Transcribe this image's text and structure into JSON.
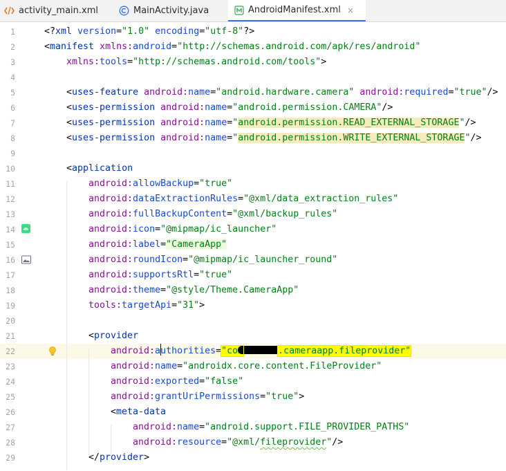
{
  "tabs": [
    {
      "label": "activity_main.xml",
      "icon": "xml-icon",
      "active": false
    },
    {
      "label": "MainActivity.java",
      "icon": "class-icon",
      "active": false
    },
    {
      "label": "AndroidManifest.xml",
      "icon": "manifest-icon",
      "active": true,
      "close": "×"
    }
  ],
  "gutter_icons": {
    "line14": "android-icon",
    "line16": "image-icon",
    "line22": "lightbulb-icon"
  },
  "lines": [
    {
      "n": "1",
      "indent": 0,
      "tokens": [
        [
          "p",
          "<?"
        ],
        [
          "k",
          "xml "
        ],
        [
          "at",
          "version"
        ],
        [
          "p",
          "="
        ],
        [
          "v",
          "\"1.0\""
        ],
        [
          "p",
          " "
        ],
        [
          "at",
          "encoding"
        ],
        [
          "p",
          "="
        ],
        [
          "v",
          "\"utf-8\""
        ],
        [
          "p",
          "?>"
        ]
      ]
    },
    {
      "n": "2",
      "indent": 0,
      "tokens": [
        [
          "p",
          "<"
        ],
        [
          "k",
          "manifest"
        ],
        [
          "p",
          " "
        ],
        [
          "ns",
          "xmlns:"
        ],
        [
          "at",
          "android"
        ],
        [
          "p",
          "="
        ],
        [
          "v",
          "\"http://schemas.android.com/apk/res/android\""
        ]
      ]
    },
    {
      "n": "3",
      "indent": 1,
      "tokens": [
        [
          "ns",
          "xmlns:"
        ],
        [
          "at",
          "tools"
        ],
        [
          "p",
          "="
        ],
        [
          "v",
          "\"http://schemas.android.com/tools\""
        ],
        [
          "p",
          ">"
        ]
      ]
    },
    {
      "n": "4",
      "indent": 0,
      "tokens": []
    },
    {
      "n": "5",
      "indent": 1,
      "tokens": [
        [
          "p",
          "<"
        ],
        [
          "k",
          "uses-feature"
        ],
        [
          "p",
          " "
        ],
        [
          "ns",
          "android:"
        ],
        [
          "at",
          "name"
        ],
        [
          "p",
          "="
        ],
        [
          "v",
          "\"android.hardware.camera\""
        ],
        [
          "p",
          " "
        ],
        [
          "ns",
          "android:"
        ],
        [
          "at",
          "required"
        ],
        [
          "p",
          "="
        ],
        [
          "v",
          "\"true\""
        ],
        [
          "p",
          "/>"
        ]
      ]
    },
    {
      "n": "6",
      "indent": 1,
      "tokens": [
        [
          "p",
          "<"
        ],
        [
          "k",
          "uses-permission"
        ],
        [
          "p",
          " "
        ],
        [
          "ns",
          "android:"
        ],
        [
          "at",
          "name"
        ],
        [
          "p",
          "="
        ],
        [
          "v",
          "\"android.permission.CAMERA\""
        ],
        [
          "p",
          "/>"
        ]
      ]
    },
    {
      "n": "7",
      "indent": 1,
      "tokens": [
        [
          "p",
          "<"
        ],
        [
          "k",
          "uses-permission"
        ],
        [
          "p",
          " "
        ],
        [
          "ns",
          "android:"
        ],
        [
          "at",
          "name"
        ],
        [
          "p",
          "="
        ],
        [
          "v",
          "\""
        ],
        [
          "v hlw",
          "android.permission.READ_EXTERNAL_STORAGE"
        ],
        [
          "v",
          "\""
        ],
        [
          "p",
          "/>"
        ]
      ]
    },
    {
      "n": "8",
      "indent": 1,
      "tokens": [
        [
          "p",
          "<"
        ],
        [
          "k",
          "uses-permission"
        ],
        [
          "p",
          " "
        ],
        [
          "ns",
          "android:"
        ],
        [
          "at",
          "name"
        ],
        [
          "p",
          "="
        ],
        [
          "v",
          "\""
        ],
        [
          "v hlw",
          "android.permission.WRITE_EXTERNAL_STORAGE"
        ],
        [
          "v",
          "\""
        ],
        [
          "p",
          "/>"
        ]
      ]
    },
    {
      "n": "9",
      "indent": 0,
      "tokens": []
    },
    {
      "n": "10",
      "indent": 1,
      "tokens": [
        [
          "p",
          "<"
        ],
        [
          "k",
          "application"
        ]
      ]
    },
    {
      "n": "11",
      "indent": 2,
      "tokens": [
        [
          "ns",
          "android:"
        ],
        [
          "at",
          "allowBackup"
        ],
        [
          "p",
          "="
        ],
        [
          "v",
          "\"true\""
        ]
      ]
    },
    {
      "n": "12",
      "indent": 2,
      "tokens": [
        [
          "ns",
          "android:"
        ],
        [
          "at",
          "dataExtractionRules"
        ],
        [
          "p",
          "="
        ],
        [
          "v",
          "\"@xml/data_extraction_rules\""
        ]
      ]
    },
    {
      "n": "13",
      "indent": 2,
      "tokens": [
        [
          "ns",
          "android:"
        ],
        [
          "at",
          "fullBackupContent"
        ],
        [
          "p",
          "="
        ],
        [
          "v",
          "\"@xml/backup_rules\""
        ]
      ]
    },
    {
      "n": "14",
      "indent": 2,
      "tokens": [
        [
          "ns",
          "android:"
        ],
        [
          "at",
          "icon"
        ],
        [
          "p",
          "="
        ],
        [
          "v",
          "\"@mipmap/ic_launcher\""
        ]
      ]
    },
    {
      "n": "15",
      "indent": 2,
      "tokens": [
        [
          "ns",
          "android:"
        ],
        [
          "at",
          "label"
        ],
        [
          "p",
          "="
        ],
        [
          "v hlg",
          "\"CameraApp\""
        ]
      ]
    },
    {
      "n": "16",
      "indent": 2,
      "tokens": [
        [
          "ns",
          "android:"
        ],
        [
          "at",
          "roundIcon"
        ],
        [
          "p",
          "="
        ],
        [
          "v",
          "\"@mipmap/ic_launcher_round\""
        ]
      ]
    },
    {
      "n": "17",
      "indent": 2,
      "tokens": [
        [
          "ns",
          "android:"
        ],
        [
          "at",
          "supportsRtl"
        ],
        [
          "p",
          "="
        ],
        [
          "v",
          "\"true\""
        ]
      ]
    },
    {
      "n": "18",
      "indent": 2,
      "tokens": [
        [
          "ns",
          "android:"
        ],
        [
          "at",
          "theme"
        ],
        [
          "p",
          "="
        ],
        [
          "v",
          "\"@style/Theme.CameraApp\""
        ]
      ]
    },
    {
      "n": "19",
      "indent": 2,
      "tokens": [
        [
          "ns",
          "tools:"
        ],
        [
          "at",
          "targetApi"
        ],
        [
          "p",
          "="
        ],
        [
          "v",
          "\"31\""
        ],
        [
          "p",
          ">"
        ]
      ]
    },
    {
      "n": "20",
      "indent": 0,
      "tokens": []
    },
    {
      "n": "21",
      "indent": 2,
      "tokens": [
        [
          "p",
          "<"
        ],
        [
          "k",
          "provider"
        ]
      ]
    },
    {
      "n": "22",
      "indent": 3,
      "highlight": true,
      "tokens": [
        [
          "ns",
          "android:"
        ],
        [
          "at",
          "a"
        ],
        [
          "caret",
          ""
        ],
        [
          "at",
          "uthorities"
        ],
        [
          "p",
          "="
        ],
        [
          "v hly",
          "\"com"
        ],
        [
          "redact",
          ""
        ],
        [
          "v hly",
          ".cameraapp.fileprovider\""
        ]
      ]
    },
    {
      "n": "23",
      "indent": 3,
      "tokens": [
        [
          "ns",
          "android:"
        ],
        [
          "at",
          "name"
        ],
        [
          "p",
          "="
        ],
        [
          "v",
          "\"androidx.core.content.FileProvider\""
        ]
      ]
    },
    {
      "n": "24",
      "indent": 3,
      "tokens": [
        [
          "ns",
          "android:"
        ],
        [
          "at",
          "exported"
        ],
        [
          "p",
          "="
        ],
        [
          "v",
          "\"false\""
        ]
      ]
    },
    {
      "n": "25",
      "indent": 3,
      "tokens": [
        [
          "ns",
          "android:"
        ],
        [
          "at",
          "grantUriPermissions"
        ],
        [
          "p",
          "="
        ],
        [
          "v",
          "\"true\""
        ],
        [
          "p",
          ">"
        ]
      ]
    },
    {
      "n": "26",
      "indent": 3,
      "tokens": [
        [
          "p",
          "<"
        ],
        [
          "k",
          "meta-data"
        ]
      ]
    },
    {
      "n": "27",
      "indent": 4,
      "tokens": [
        [
          "ns",
          "android:"
        ],
        [
          "at",
          "name"
        ],
        [
          "p",
          "="
        ],
        [
          "v",
          "\"android.support.FILE_PROVIDER_PATHS\""
        ]
      ]
    },
    {
      "n": "28",
      "indent": 4,
      "tokens": [
        [
          "ns",
          "android:"
        ],
        [
          "at",
          "resource"
        ],
        [
          "p",
          "="
        ],
        [
          "v",
          "\"@xml/"
        ],
        [
          "v squig",
          "fileprovider"
        ],
        [
          "v",
          "\""
        ],
        [
          "p",
          "/>"
        ]
      ]
    },
    {
      "n": "29",
      "indent": 2,
      "tokens": [
        [
          "p",
          "</"
        ],
        [
          "k",
          "provider"
        ],
        [
          "p",
          ">"
        ]
      ]
    }
  ]
}
